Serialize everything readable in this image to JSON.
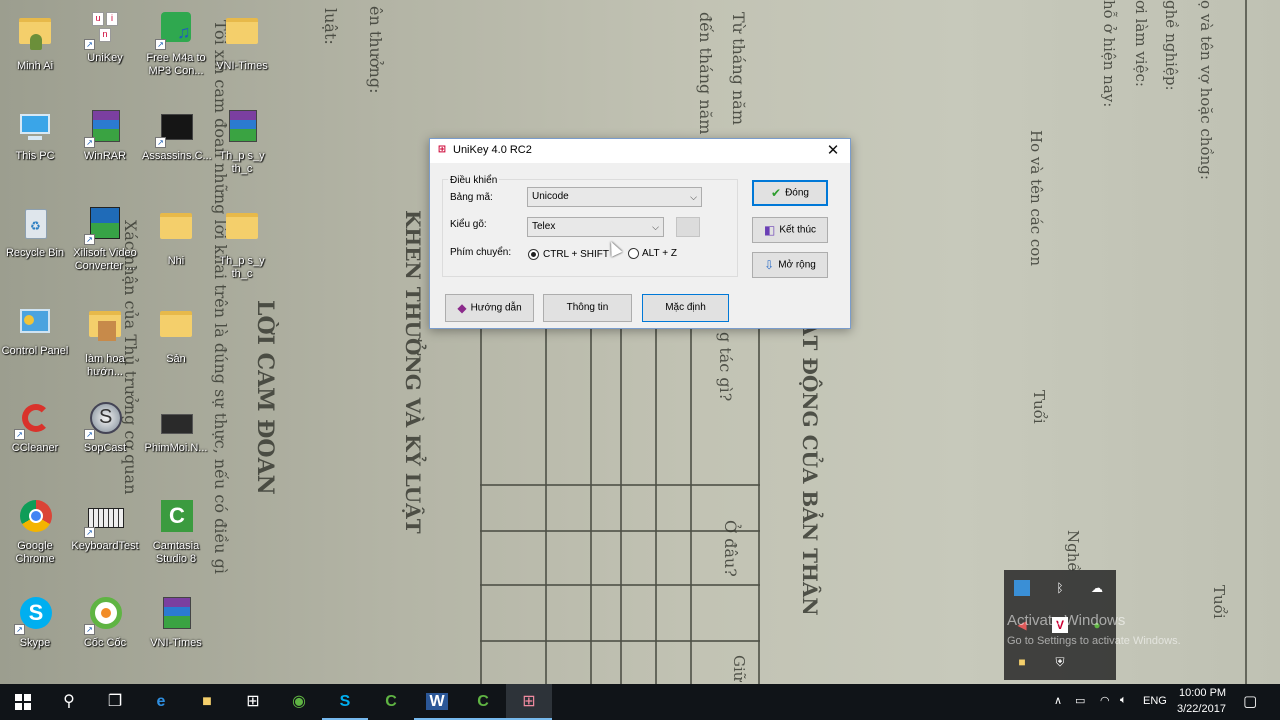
{
  "wallpaper": {
    "texts": [
      "LỜI CAM ĐOAN",
      "KHEN THƯỞNG VÀ KỶ LUẬT",
      "ẠT ĐỘNG CỦA BẢN THÂN",
      "Ho và tên các con",
      "Tuổi",
      "Ở đâu?",
      "g tác gì?",
      "Từ tháng năm",
      "đến tháng năm",
      "Tôi xin cam đoan những lời khai trên là đúng sự thực, nếu có điều gì",
      "Xác nhận của Thủ trưởng cơ quan",
      "luật:",
      "ên thưởng:",
      "ọ và tên vợ hoặc chồng:",
      "ghề nghiệp:",
      "ơi làm việc:",
      "hỗ ở hiện nay:",
      "Nghề",
      "Tuổi",
      "Giữ"
    ]
  },
  "desktop_icons": [
    {
      "label": "Minh Ai",
      "icon": "user-folder-icon"
    },
    {
      "label": "UniKey",
      "icon": "unikey-icon"
    },
    {
      "label": "Free M4a to MP3 Con...",
      "icon": "audio-converter-icon"
    },
    {
      "label": "VNI-Times",
      "icon": "font-file-icon"
    },
    {
      "label": "This PC",
      "icon": "computer-icon"
    },
    {
      "label": "WinRAR",
      "icon": "winrar-icon"
    },
    {
      "label": "Assassins.C...",
      "icon": "game-icon"
    },
    {
      "label": "Th_p s_y th_c",
      "icon": "winrar-archive-icon"
    },
    {
      "label": "Recycle Bin",
      "icon": "recycle-bin-icon"
    },
    {
      "label": "Xilisoft Video Converter ...",
      "icon": "video-converter-icon"
    },
    {
      "label": "Nhi",
      "icon": "folder-icon"
    },
    {
      "label": "Th_p s_y th_c",
      "icon": "document-folder-icon"
    },
    {
      "label": "Control Panel",
      "icon": "control-panel-icon"
    },
    {
      "label": "làm hoa hướn...",
      "icon": "image-folder-icon"
    },
    {
      "label": "Sản",
      "icon": "folder-icon"
    },
    {
      "label": "CCleaner",
      "icon": "ccleaner-icon"
    },
    {
      "label": "SopCast",
      "icon": "sopcast-icon"
    },
    {
      "label": "PhimMoi.N...",
      "icon": "video-file-icon"
    },
    {
      "label": "Google Chrome",
      "icon": "chrome-icon"
    },
    {
      "label": "KeyboardTest",
      "icon": "keyboard-icon"
    },
    {
      "label": "Camtasia Studio 8",
      "icon": "camtasia-icon"
    },
    {
      "label": "Skype",
      "icon": "skype-icon"
    },
    {
      "label": "Cốc Cốc",
      "icon": "coccoc-icon"
    },
    {
      "label": "VNI-Times",
      "icon": "winrar-archive-icon"
    }
  ],
  "dialog": {
    "title": "UniKey 4.0 RC2",
    "group_title": "Điều khiển",
    "encoding_label": "Bảng mã:",
    "encoding_value": "Unicode",
    "input_label": "Kiểu gõ:",
    "input_value": "Telex",
    "switch_label": "Phím chuyển:",
    "switch_options": [
      "CTRL + SHIFT",
      "ALT + Z"
    ],
    "switch_selected": 0,
    "buttons": {
      "close": "Đóng",
      "exit": "Kết thúc",
      "expand": "Mở rộng",
      "help": "Hướng dẫn",
      "info": "Thông tin",
      "default": "Mặc định"
    }
  },
  "watermark": {
    "line1": "Activate Windows",
    "line2": "Go to Settings to activate Windows."
  },
  "taskbar": {
    "language": "ENG",
    "time": "10:00 PM",
    "date": "3/22/2017"
  }
}
